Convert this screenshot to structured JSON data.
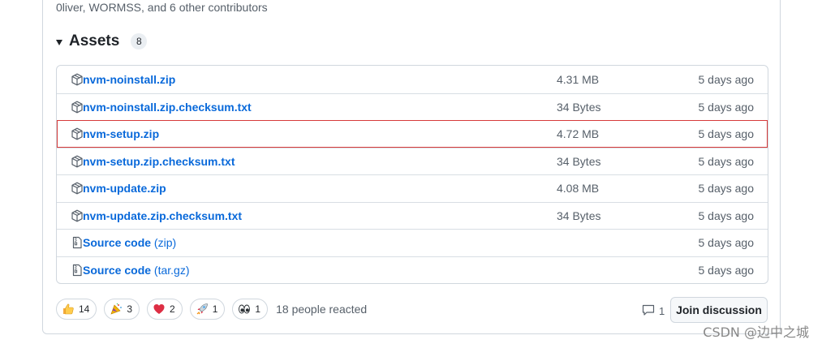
{
  "release": {
    "contributors_text": "0liver, WORMSS, and 6 other contributors"
  },
  "assets": {
    "title": "Assets",
    "count": "8",
    "items": [
      {
        "icon": "package-icon",
        "name": "nvm-noinstall.zip",
        "ext": "",
        "size": "4.31 MB",
        "date": "5 days ago"
      },
      {
        "icon": "package-icon",
        "name": "nvm-noinstall.zip.checksum.txt",
        "ext": "",
        "size": "34 Bytes",
        "date": "5 days ago"
      },
      {
        "icon": "package-icon",
        "name": "nvm-setup.zip",
        "ext": "",
        "size": "4.72 MB",
        "date": "5 days ago"
      },
      {
        "icon": "package-icon",
        "name": "nvm-setup.zip.checksum.txt",
        "ext": "",
        "size": "34 Bytes",
        "date": "5 days ago"
      },
      {
        "icon": "package-icon",
        "name": "nvm-update.zip",
        "ext": "",
        "size": "4.08 MB",
        "date": "5 days ago"
      },
      {
        "icon": "package-icon",
        "name": "nvm-update.zip.checksum.txt",
        "ext": "",
        "size": "34 Bytes",
        "date": "5 days ago"
      },
      {
        "icon": "file-zip-icon",
        "name": "Source code",
        "ext": "(zip)",
        "size": "",
        "date": "5 days ago"
      },
      {
        "icon": "file-zip-icon",
        "name": "Source code",
        "ext": "(tar.gz)",
        "size": "",
        "date": "5 days ago"
      }
    ]
  },
  "reactions": {
    "thumbs_up": "14",
    "tada": "3",
    "heart": "2",
    "rocket": "1",
    "eyes": "1",
    "summary": "18 people reacted"
  },
  "discussion": {
    "comment_count": "1",
    "join_label": "Join discussion"
  },
  "watermark": "CSDN @边中之城",
  "colors": {
    "link": "#0969da",
    "highlight_border": "#d73a3a",
    "muted_text": "#57606a"
  }
}
